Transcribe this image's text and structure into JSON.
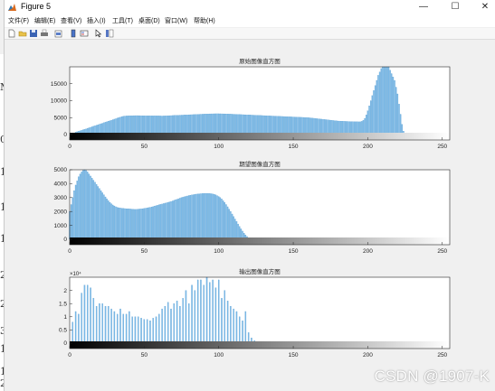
{
  "window": {
    "title": "Figure 5",
    "controls": {
      "minimize": "—",
      "maximize": "☐",
      "close": "✕"
    }
  },
  "menu": [
    "文件(F)",
    "编辑(E)",
    "查看(V)",
    "插入(I)",
    "工具(T)",
    "桌面(D)",
    "窗口(W)",
    "帮助(H)"
  ],
  "toolbar_icons": [
    "new-figure-icon",
    "open-file-icon",
    "save-icon",
    "print-icon",
    "print-preview-icon",
    "zoom-colorbar-icon",
    "insert-legend-icon",
    "pointer-arrow-icon",
    "property-editor-icon"
  ],
  "background_marks": [
    "M",
    "0",
    "1",
    "1",
    "1",
    "2",
    "2",
    "3",
    "1",
    "1",
    "2"
  ],
  "watermark": "CSDN @1907-K",
  "colors": {
    "bar": "#7fbce8",
    "bar_stroke": "#4a96cf",
    "axes": "#262626"
  },
  "chart_data": [
    {
      "type": "bar",
      "title": "原始图像直方图",
      "xlim": [
        0,
        255
      ],
      "ylim": [
        0,
        20000
      ],
      "xticks": [
        0,
        50,
        100,
        150,
        200,
        250
      ],
      "yticks": [
        0,
        5000,
        10000,
        15000
      ],
      "ytick_labels": [
        "0",
        "5000",
        "10000",
        "15000"
      ],
      "multiplier": "",
      "grayscale_colorbar": true,
      "values": [
        0,
        0,
        0,
        400,
        700,
        850,
        1000,
        1100,
        1250,
        1400,
        1550,
        1700,
        1850,
        2000,
        2150,
        2300,
        2450,
        2600,
        2750,
        2900,
        3050,
        3200,
        3350,
        3500,
        3650,
        3800,
        3950,
        4100,
        4250,
        4400,
        4550,
        4700,
        4850,
        5000,
        5150,
        5300,
        5400,
        5450,
        5500,
        5520,
        5550,
        5560,
        5570,
        5580,
        5590,
        5600,
        5590,
        5580,
        5570,
        5560,
        5550,
        5540,
        5530,
        5520,
        5520,
        5520,
        5520,
        5520,
        5520,
        5520,
        5520,
        5500,
        5480,
        5500,
        5520,
        5540,
        5560,
        5580,
        5600,
        5620,
        5640,
        5660,
        5680,
        5700,
        5720,
        5740,
        5760,
        5780,
        5800,
        5820,
        5840,
        5860,
        5880,
        5900,
        5920,
        5940,
        5960,
        5980,
        6000,
        6020,
        6040,
        6060,
        6080,
        6100,
        6110,
        6120,
        6130,
        6140,
        6150,
        6160,
        6150,
        6140,
        6130,
        6120,
        6110,
        6100,
        6080,
        6060,
        6040,
        6020,
        6000,
        5980,
        5960,
        5940,
        5920,
        5900,
        5880,
        5860,
        5840,
        5820,
        5800,
        5780,
        5760,
        5740,
        5720,
        5700,
        5680,
        5660,
        5640,
        5620,
        5600,
        5580,
        5560,
        5540,
        5520,
        5500,
        5480,
        5460,
        5440,
        5420,
        5400,
        5380,
        5360,
        5340,
        5320,
        5300,
        5280,
        5260,
        5240,
        5220,
        5200,
        5180,
        5160,
        5140,
        5120,
        5100,
        5080,
        5060,
        5040,
        5020,
        5000,
        4950,
        4900,
        4850,
        4800,
        4750,
        4700,
        4650,
        4600,
        4550,
        4500,
        4450,
        4400,
        4350,
        4300,
        4250,
        4200,
        4150,
        4100,
        4050,
        4000,
        3980,
        3960,
        3940,
        3920,
        3900,
        3880,
        3860,
        3840,
        3820,
        3800,
        3790,
        3780,
        3770,
        3760,
        3800,
        3900,
        4200,
        4800,
        5800,
        7000,
        8500,
        10000,
        11500,
        13000,
        14500,
        16000,
        17500,
        18500,
        19500,
        20000,
        20000,
        20000,
        20000,
        20000,
        19000,
        18000,
        17000,
        16000,
        14000,
        12000,
        9000,
        6000,
        3000,
        1000,
        300,
        100,
        0,
        0,
        0,
        0,
        0,
        0,
        0,
        0,
        0,
        0,
        0,
        0,
        0,
        0,
        0,
        0,
        0,
        0,
        0,
        0,
        0,
        0,
        0,
        0,
        0,
        0,
        0,
        0,
        0
      ]
    },
    {
      "type": "bar",
      "title": "期望图像直方图",
      "xlim": [
        0,
        255
      ],
      "ylim": [
        0,
        5000
      ],
      "xticks": [
        0,
        50,
        100,
        150,
        200,
        250
      ],
      "yticks": [
        0,
        1000,
        2000,
        3000,
        4000,
        5000
      ],
      "ytick_labels": [
        "0",
        "1000",
        "2000",
        "3000",
        "4000",
        "5000"
      ],
      "multiplier": "",
      "grayscale_colorbar": true,
      "values": [
        2000,
        2500,
        3000,
        3500,
        3900,
        4200,
        4500,
        4700,
        4850,
        4950,
        5000,
        4950,
        4850,
        4700,
        4550,
        4400,
        4250,
        4100,
        3950,
        3800,
        3650,
        3500,
        3350,
        3200,
        3050,
        2900,
        2780,
        2660,
        2560,
        2470,
        2400,
        2340,
        2300,
        2270,
        2250,
        2230,
        2220,
        2210,
        2200,
        2200,
        2190,
        2180,
        2170,
        2160,
        2150,
        2160,
        2170,
        2180,
        2190,
        2200,
        2220,
        2240,
        2260,
        2280,
        2300,
        2330,
        2360,
        2390,
        2420,
        2450,
        2480,
        2510,
        2540,
        2570,
        2600,
        2630,
        2660,
        2690,
        2720,
        2760,
        2800,
        2840,
        2880,
        2920,
        2960,
        3000,
        3030,
        3060,
        3090,
        3120,
        3150,
        3170,
        3190,
        3210,
        3230,
        3250,
        3260,
        3270,
        3280,
        3290,
        3300,
        3300,
        3300,
        3300,
        3290,
        3280,
        3260,
        3230,
        3190,
        3140,
        3080,
        3000,
        2900,
        2780,
        2650,
        2500,
        2340,
        2170,
        2000,
        1820,
        1640,
        1460,
        1280,
        1100,
        920,
        750,
        590,
        440,
        310,
        200,
        110,
        50,
        20,
        10,
        0,
        0,
        0,
        0,
        0,
        0,
        0,
        0,
        0,
        0,
        0,
        0,
        0,
        0,
        0,
        0,
        0,
        0,
        0,
        0,
        0,
        0,
        0,
        0,
        0,
        0,
        0,
        0,
        0,
        0,
        0,
        0,
        0,
        0,
        0,
        0,
        0,
        0,
        0,
        0,
        0,
        0,
        0,
        0,
        0,
        0,
        0,
        0,
        0,
        0,
        0,
        0,
        0,
        0,
        0,
        0,
        0,
        0,
        0,
        0,
        0,
        0,
        0,
        0,
        0,
        0,
        0,
        0,
        0,
        0,
        0,
        0,
        0,
        0,
        0,
        0,
        0,
        0,
        0,
        0,
        0,
        0,
        0,
        0,
        0,
        0,
        0,
        0,
        0,
        0,
        0,
        0,
        0,
        0,
        0,
        0,
        0,
        0,
        0,
        0,
        0,
        0,
        0,
        0,
        0,
        0,
        0,
        0,
        0,
        0,
        0,
        0,
        0,
        0,
        0,
        0,
        0,
        0,
        0,
        0,
        0,
        0,
        0,
        0,
        0,
        0,
        0,
        0,
        0,
        0,
        0,
        0
      ]
    },
    {
      "type": "bar",
      "title": "输出图像直方图",
      "xlim": [
        0,
        255
      ],
      "ylim": [
        0,
        2.5
      ],
      "xticks": [
        0,
        50,
        100,
        150,
        200,
        250
      ],
      "yticks": [
        0,
        0.5,
        1,
        1.5,
        2
      ],
      "ytick_labels": [
        "0",
        "0.5",
        "1",
        "1.5",
        "2"
      ],
      "multiplier": "×10⁴",
      "grayscale_colorbar": true,
      "values": [
        0,
        0,
        0.8,
        0,
        1.2,
        0,
        1.1,
        0,
        1.9,
        0,
        2.2,
        0,
        2.2,
        0,
        2.1,
        0,
        1.7,
        0,
        1.4,
        0,
        1.5,
        0,
        1.5,
        0,
        1.4,
        0,
        1.4,
        0,
        1.3,
        0,
        1.2,
        0,
        1.1,
        0,
        1.3,
        0,
        1.1,
        0,
        1.1,
        0,
        1.2,
        0,
        1.0,
        0,
        1.0,
        0,
        1.0,
        0,
        0.95,
        0,
        0.9,
        0,
        0.9,
        0,
        0.85,
        0,
        0.95,
        0,
        1.0,
        0,
        1.1,
        0,
        1.3,
        0,
        1.4,
        0,
        1.55,
        0,
        1.3,
        0,
        1.5,
        0,
        1.6,
        0,
        1.4,
        0,
        1.7,
        0,
        2.0,
        0,
        1.5,
        0,
        2.2,
        0,
        2.0,
        0,
        2.4,
        0,
        2.4,
        0,
        2.2,
        0,
        2.5,
        0,
        2.3,
        0,
        2.4,
        0,
        2.1,
        0,
        2.4,
        0,
        1.7,
        0,
        2.0,
        0,
        1.6,
        0,
        1.4,
        0,
        1.3,
        0,
        1.2,
        0,
        1.0,
        0,
        0.85,
        0,
        1.2,
        0,
        0.4,
        0,
        0.2,
        0,
        0.1,
        0,
        0.05,
        0,
        0,
        0,
        0,
        0,
        0,
        0,
        0,
        0,
        0,
        0,
        0,
        0,
        0,
        0,
        0,
        0,
        0,
        0,
        0,
        0,
        0,
        0,
        0,
        0,
        0,
        0,
        0,
        0,
        0,
        0,
        0,
        0,
        0,
        0,
        0,
        0,
        0,
        0,
        0,
        0,
        0,
        0,
        0,
        0,
        0,
        0,
        0,
        0,
        0,
        0,
        0,
        0,
        0,
        0,
        0,
        0,
        0,
        0,
        0,
        0,
        0,
        0,
        0,
        0,
        0,
        0,
        0,
        0,
        0,
        0,
        0,
        0,
        0,
        0,
        0,
        0,
        0,
        0,
        0,
        0,
        0,
        0,
        0,
        0,
        0,
        0,
        0,
        0,
        0,
        0,
        0,
        0,
        0,
        0,
        0,
        0,
        0,
        0,
        0,
        0,
        0,
        0,
        0,
        0,
        0,
        0,
        0,
        0,
        0,
        0,
        0,
        0,
        0,
        0,
        0,
        0,
        0,
        0,
        0,
        0,
        0,
        0,
        0,
        0,
        0,
        0,
        0,
        0
      ]
    }
  ]
}
